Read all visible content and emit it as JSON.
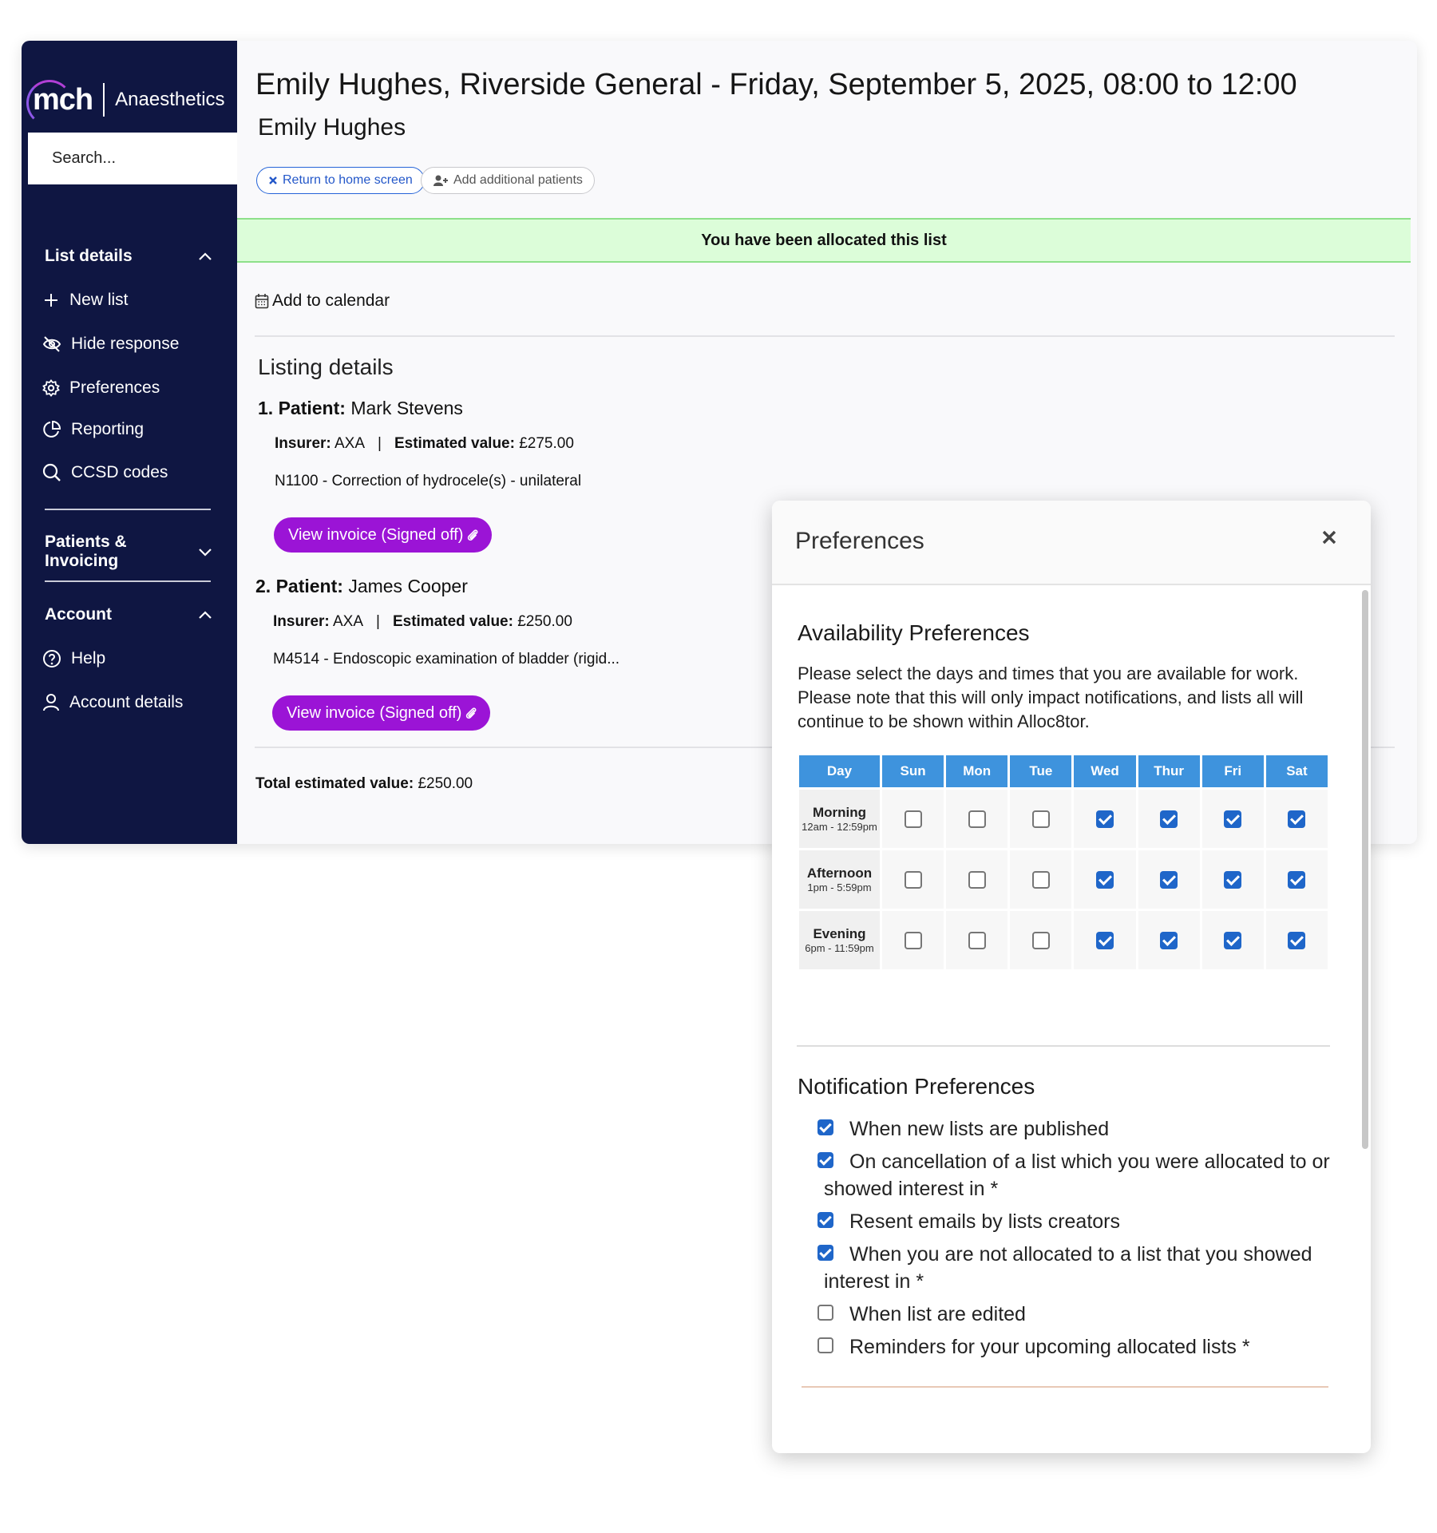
{
  "sidebar": {
    "brand": "mch",
    "product": "Anaesthetics",
    "search_placeholder": "Search...",
    "sections": {
      "list_details": "List details",
      "patients_invoicing": "Patients & Invoicing",
      "account": "Account"
    },
    "items": {
      "new_list": "New list",
      "hide_response": "Hide response",
      "preferences": "Preferences",
      "reporting": "Reporting",
      "ccsd_codes": "CCSD codes",
      "help": "Help",
      "account_details": "Account details"
    }
  },
  "header": {
    "title": "Emily Hughes, Riverside General - Friday, September 5, 2025, 08:00 to 12:00",
    "subtitle": "Emily Hughes",
    "return_label": "Return to home screen",
    "add_patients_label": "Add additional patients"
  },
  "alert": {
    "message": "You have been allocated this list"
  },
  "calendar": {
    "label": "Add to calendar"
  },
  "listing": {
    "title": "Listing details",
    "patients": [
      {
        "index": "1.",
        "label": "Patient:",
        "name": "Mark Stevens",
        "insurer_label": "Insurer:",
        "insurer": "AXA",
        "value_label": "Estimated value:",
        "value": "£275.00",
        "procedure": "N1100 - Correction of hydrocele(s) - unilateral",
        "invoice_label": "View invoice (Signed off)"
      },
      {
        "index": "2.",
        "label": "Patient:",
        "name": "James Cooper",
        "insurer_label": "Insurer:",
        "insurer": "AXA",
        "value_label": "Estimated value:",
        "value": "£250.00",
        "procedure": "M4514 - Endoscopic examination of bladder (rigid...",
        "invoice_label": "View invoice (Signed off)"
      }
    ],
    "total_label": "Total estimated value:",
    "total_value": "£250.00",
    "separator": "|"
  },
  "modal": {
    "title": "Preferences",
    "availability": {
      "title": "Availability Preferences",
      "description": "Please select the days and times that you are available for work. Please note that this will only impact notifications, and lists all will continue to be shown within Alloc8tor.",
      "day_header": "Day",
      "days": [
        "Sun",
        "Mon",
        "Tue",
        "Wed",
        "Thur",
        "Fri",
        "Sat"
      ],
      "slots": [
        {
          "name": "Morning",
          "range": "12am - 12:59pm",
          "checked": [
            false,
            false,
            false,
            true,
            true,
            true,
            true
          ]
        },
        {
          "name": "Afternoon",
          "range": "1pm - 5:59pm",
          "checked": [
            false,
            false,
            false,
            true,
            true,
            true,
            true
          ]
        },
        {
          "name": "Evening",
          "range": "6pm - 11:59pm",
          "checked": [
            false,
            false,
            false,
            true,
            true,
            true,
            true
          ]
        }
      ]
    },
    "notifications": {
      "title": "Notification Preferences",
      "items": [
        {
          "label": "When new lists are published",
          "checked": true
        },
        {
          "label": "On cancellation of a list which you were allocated to or showed interest in *",
          "checked": true
        },
        {
          "label": "Resent emails by lists creators",
          "checked": true
        },
        {
          "label": "When you are not allocated to a list that you showed interest in *",
          "checked": true
        },
        {
          "label": "When list are edited",
          "checked": false
        },
        {
          "label": "Reminders for your upcoming allocated lists *",
          "checked": false
        }
      ]
    }
  },
  "colors": {
    "sidebar_bg": "#0f1642",
    "accent_blue": "#3e93dd",
    "checkbox_blue": "#1f66c9",
    "invoice_purple": "#9b14d6",
    "alert_green": "#dcfdd9"
  },
  "icons": {
    "plus": "plus-icon",
    "hide": "eye-off-icon",
    "preferences": "gear-icon",
    "reporting": "pie-chart-icon",
    "ccsd": "search-icon",
    "help": "help-circle-icon",
    "account": "user-icon",
    "close": "close-icon",
    "calendar": "calendar-icon",
    "attachment": "paperclip-icon"
  }
}
